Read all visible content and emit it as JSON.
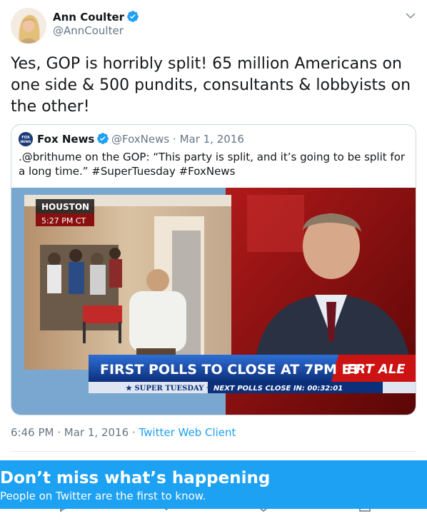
{
  "tweet": {
    "author": {
      "name": "Ann Coulter",
      "handle": "@AnnCoulter",
      "verified": true
    },
    "text": "Yes, GOP is horribly split!  65 million Americans on one side & 500 pundits, consultants & lobbyists on the other!",
    "timestamp": "6:46 PM",
    "date": "Mar 1, 2016",
    "source": "Twitter Web Client",
    "separator": "·"
  },
  "quoted_tweet": {
    "author": {
      "name": "Fox News",
      "handle": "@FoxNews",
      "verified": true
    },
    "date": "Mar 1, 2016",
    "separator": "·",
    "text": ".@brithume on the GOP: “This party is split, and it’s going to be split for a long time.” #SuperTuesday #FoxNews",
    "media": {
      "location": "HOUSTON",
      "time": "5:27 PM CT",
      "headline": "FIRST POLLS TO CLOSE AT 7PM ET",
      "alert": "ERT  ALE",
      "ticker_left": "★ SUPER TUESDAY ★",
      "ticker_right": "NEXT POLLS CLOSE IN: 00:32:01",
      "logo_text": "FOX NEWS"
    }
  },
  "banner": {
    "title": "Don’t miss what’s happening",
    "subtitle": "People on Twitter are the first to know."
  },
  "icons": [
    "verified-badge-icon",
    "chevron-down-icon",
    "reply-icon",
    "retweet-icon",
    "like-icon",
    "share-icon"
  ],
  "colors": {
    "accent": "#1da1f2",
    "text": "#14171a",
    "muted": "#657786",
    "border": "#ccd6dd"
  }
}
